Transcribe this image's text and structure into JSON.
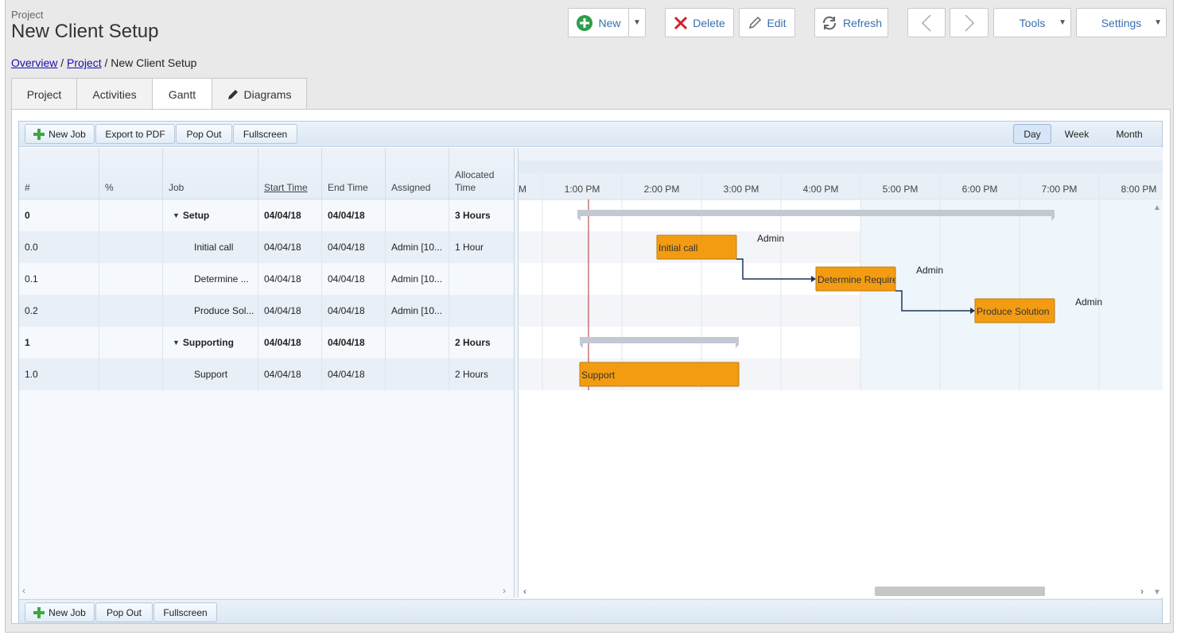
{
  "header": {
    "project_label": "Project",
    "title": "New Client Setup"
  },
  "breadcrumb": {
    "overview": "Overview",
    "separator": " / ",
    "project": "Project",
    "current": "New Client Setup"
  },
  "toolbar": {
    "new_label": "New",
    "delete_label": "Delete",
    "edit_label": "Edit",
    "refresh_label": "Refresh",
    "tools_label": "Tools",
    "settings_label": "Settings"
  },
  "tabs": [
    {
      "label": "Project"
    },
    {
      "label": "Activities"
    },
    {
      "label": "Gantt"
    },
    {
      "label": "Diagrams"
    }
  ],
  "gantt_toolbar": {
    "new_job": "New Job",
    "export_pdf": "Export to PDF",
    "pop_out": "Pop Out",
    "fullscreen": "Fullscreen",
    "views": [
      "Day",
      "Week",
      "Month"
    ],
    "selected_view": "Day"
  },
  "grid": {
    "columns": [
      "#",
      "%",
      "Job",
      "Start Time",
      "End Time",
      "Assigned",
      "Allocated Time"
    ],
    "rows": [
      {
        "id": "0",
        "pct": "",
        "job": "Setup",
        "start": "04/04/18",
        "end": "04/04/18",
        "assigned": "",
        "alloc": "3 Hours",
        "summary": true
      },
      {
        "id": "0.0",
        "pct": "",
        "job": "Initial call",
        "start": "04/04/18",
        "end": "04/04/18",
        "assigned": "Admin [10...",
        "alloc": "1 Hour",
        "summary": false
      },
      {
        "id": "0.1",
        "pct": "",
        "job": "Determine ...",
        "start": "04/04/18",
        "end": "04/04/18",
        "assigned": "Admin [10...",
        "alloc": "",
        "summary": false
      },
      {
        "id": "0.2",
        "pct": "",
        "job": "Produce Sol...",
        "start": "04/04/18",
        "end": "04/04/18",
        "assigned": "Admin [10...",
        "alloc": "",
        "summary": false
      },
      {
        "id": "1",
        "pct": "",
        "job": "Supporting",
        "start": "04/04/18",
        "end": "04/04/18",
        "assigned": "",
        "alloc": "2 Hours",
        "summary": true
      },
      {
        "id": "1.0",
        "pct": "",
        "job": "Support",
        "start": "04/04/18",
        "end": "04/04/18",
        "assigned": "",
        "alloc": "2 Hours",
        "summary": false
      }
    ]
  },
  "timeline": {
    "hours": [
      "M",
      "1:00 PM",
      "2:00 PM",
      "3:00 PM",
      "4:00 PM",
      "5:00 PM",
      "6:00 PM",
      "7:00 PM",
      "8:00 PM"
    ],
    "bars": [
      {
        "row": 1,
        "label": "Initial call",
        "resource": "Admin"
      },
      {
        "row": 2,
        "label": "Determine Require",
        "resource": "Admin"
      },
      {
        "row": 3,
        "label": "Produce Solution",
        "resource": "Admin"
      },
      {
        "row": 5,
        "label": "Support",
        "resource": ""
      }
    ],
    "bar_color": "#f39c12",
    "summary_color": "#c3c9d3",
    "now_line_color": "#b03030"
  },
  "gantt_footer": {
    "new_job": "New Job",
    "pop_out": "Pop Out",
    "fullscreen": "Fullscreen"
  }
}
